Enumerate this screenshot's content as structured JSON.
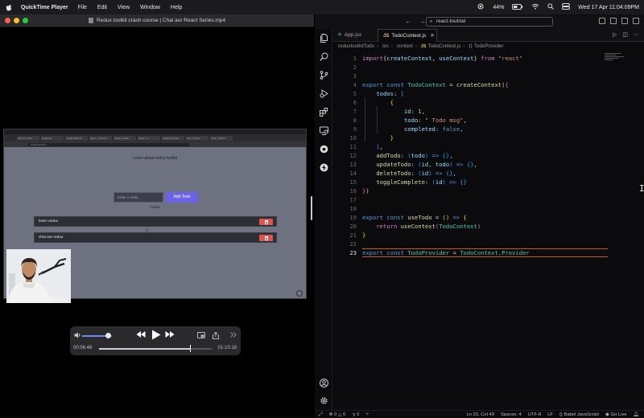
{
  "menubar": {
    "app_name": "QuickTime Player",
    "menus": [
      "File",
      "Edit",
      "View",
      "Window",
      "Help"
    ],
    "battery": "44%",
    "datetime": "Wed 17 Apr  11:04:09PM"
  },
  "quicktime": {
    "window_title": "Redux toolkit crash course | Chai aur React Series.mp4",
    "current_time": "00:56:48",
    "duration": "01:10:18",
    "progress": 0.81,
    "volume": 0.85
  },
  "browser": {
    "tabs": [
      "chai aur code",
      "localhost",
      "Install Tailwind CSS",
      "redux - Chrome",
      "Redux Toolkit",
      "Redux - A predictable",
      "Getting Started",
      "Vite + React",
      "Chai + Redux"
    ],
    "url": "localhost:5173",
    "heading": "Learn about redux toolkit",
    "input_placeholder": "Enter a Todo...",
    "add_button": "Add Todo",
    "todos_heading": "Todos",
    "todos": [
      "learn redux",
      "chai aur redux"
    ]
  },
  "vscode": {
    "search": "react-toutrial",
    "tabs": [
      {
        "label": "App.jsx",
        "active": false
      },
      {
        "label": "TodoContext.js",
        "active": true
      }
    ],
    "breadcrumb": [
      "reduxtoolkitTodo",
      "src",
      "context",
      "TodoContext.js",
      "TodoProvider"
    ],
    "line_numbers": [
      "1",
      "2",
      "3",
      "4",
      "5",
      "6",
      "7",
      "8",
      "9",
      "10",
      "11",
      "12",
      "13",
      "14",
      "15",
      "16",
      "17",
      "18",
      "19",
      "20",
      "21",
      "22",
      "23"
    ],
    "current_line": 23,
    "status": {
      "errors": "0",
      "warnings": "0",
      "info": "0",
      "position": "Ln 23, Col 49",
      "spaces": "Spaces: 4",
      "encoding": "UTF-8",
      "eol": "LF",
      "language": "Babel JavaScript",
      "golive": "Go Live"
    }
  },
  "code": [
    [
      [
        "kw",
        "import"
      ],
      [
        "",
        "{"
      ],
      [
        "var",
        "createContext"
      ],
      [
        "",
        ", "
      ],
      [
        "var",
        "useContext"
      ],
      [
        "",
        "} "
      ],
      [
        "kw",
        "from"
      ],
      [
        "str",
        " \"react\""
      ]
    ],
    [],
    [],
    [
      [
        "kw2",
        "export"
      ],
      [
        "kw2",
        " const"
      ],
      [
        "cls",
        " TodoContext"
      ],
      [
        "",
        " = "
      ],
      [
        "fn",
        "createContext"
      ],
      [
        "br1",
        "("
      ],
      [
        "br2",
        "{"
      ]
    ],
    [
      [
        "",
        "    "
      ],
      [
        "var",
        "todos"
      ],
      [
        "",
        ": "
      ],
      [
        "br3",
        "["
      ]
    ],
    [
      [
        "",
        "        "
      ],
      [
        "br1",
        "{"
      ]
    ],
    [
      [
        "",
        "            "
      ],
      [
        "var",
        "id"
      ],
      [
        "",
        ": "
      ],
      [
        "num",
        "1"
      ],
      [
        "",
        ","
      ]
    ],
    [
      [
        "",
        "            "
      ],
      [
        "var",
        "todo"
      ],
      [
        "",
        ": "
      ],
      [
        "str",
        "\" Todo msg\""
      ],
      [
        "",
        ","
      ]
    ],
    [
      [
        "",
        "            "
      ],
      [
        "var",
        "completed"
      ],
      [
        "",
        ": "
      ],
      [
        "bool",
        "false"
      ],
      [
        "",
        ","
      ]
    ],
    [
      [
        "",
        "        "
      ],
      [
        "br1",
        "}"
      ]
    ],
    [
      [
        "",
        "    "
      ],
      [
        "br3",
        "]"
      ],
      [
        "",
        ","
      ]
    ],
    [
      [
        "",
        "    "
      ],
      [
        "fn",
        "addTodo"
      ],
      [
        "",
        ": "
      ],
      [
        "br3",
        "("
      ],
      [
        "var",
        "todo"
      ],
      [
        "br3",
        ")"
      ],
      [
        "kw2",
        " =>"
      ],
      [
        "",
        " "
      ],
      [
        "br3",
        "{}"
      ],
      [
        "",
        ","
      ]
    ],
    [
      [
        "",
        "    "
      ],
      [
        "fn",
        "updateTodo"
      ],
      [
        "",
        ": "
      ],
      [
        "br3",
        "("
      ],
      [
        "var",
        "id"
      ],
      [
        "",
        ", "
      ],
      [
        "var",
        "todo"
      ],
      [
        "br3",
        ")"
      ],
      [
        "kw2",
        " =>"
      ],
      [
        "",
        " "
      ],
      [
        "br3",
        "{}"
      ],
      [
        "",
        ","
      ]
    ],
    [
      [
        "",
        "    "
      ],
      [
        "fn",
        "deleteTodo"
      ],
      [
        "",
        ": "
      ],
      [
        "br3",
        "("
      ],
      [
        "var",
        "id"
      ],
      [
        "br3",
        ")"
      ],
      [
        "kw2",
        " =>"
      ],
      [
        "",
        " "
      ],
      [
        "br3",
        "{}"
      ],
      [
        "",
        ","
      ]
    ],
    [
      [
        "",
        "    "
      ],
      [
        "fn",
        "toggleComplete"
      ],
      [
        "",
        ": "
      ],
      [
        "br3",
        "("
      ],
      [
        "var",
        "id"
      ],
      [
        "br3",
        ")"
      ],
      [
        "kw2",
        " =>"
      ],
      [
        "",
        " "
      ],
      [
        "br3",
        "{}"
      ]
    ],
    [
      [
        "br2",
        "}"
      ],
      [
        "br1",
        ")"
      ]
    ],
    [],
    [],
    [
      [
        "kw2",
        "export"
      ],
      [
        "kw2",
        " const"
      ],
      [
        "fn",
        " useTodo"
      ],
      [
        "",
        " = "
      ],
      [
        "br1",
        "()"
      ],
      [
        "kw2",
        " =>"
      ],
      [
        "",
        " "
      ],
      [
        "br1",
        "{"
      ]
    ],
    [
      [
        "",
        "    "
      ],
      [
        "kw",
        "return"
      ],
      [
        "fn",
        " useContext"
      ],
      [
        "br2",
        "("
      ],
      [
        "cls",
        "TodoContext"
      ],
      [
        "br2",
        ")"
      ]
    ],
    [
      [
        "br1",
        "}"
      ]
    ],
    [],
    [
      [
        "kw2",
        "export"
      ],
      [
        "kw2",
        " const"
      ],
      [
        "cls",
        " TodoProvider"
      ],
      [
        "",
        " = "
      ],
      [
        "cls",
        "TodoContext"
      ],
      [
        "",
        "."
      ],
      [
        "cls",
        "Provider"
      ]
    ]
  ],
  "icons": {
    "activity_bar": [
      "files-icon",
      "search-icon",
      "source-control-icon",
      "run-debug-icon",
      "extensions-icon",
      "remote-explorer-icon",
      "github-icon",
      "thunder-client-icon"
    ],
    "accent": "#c95a1f"
  }
}
